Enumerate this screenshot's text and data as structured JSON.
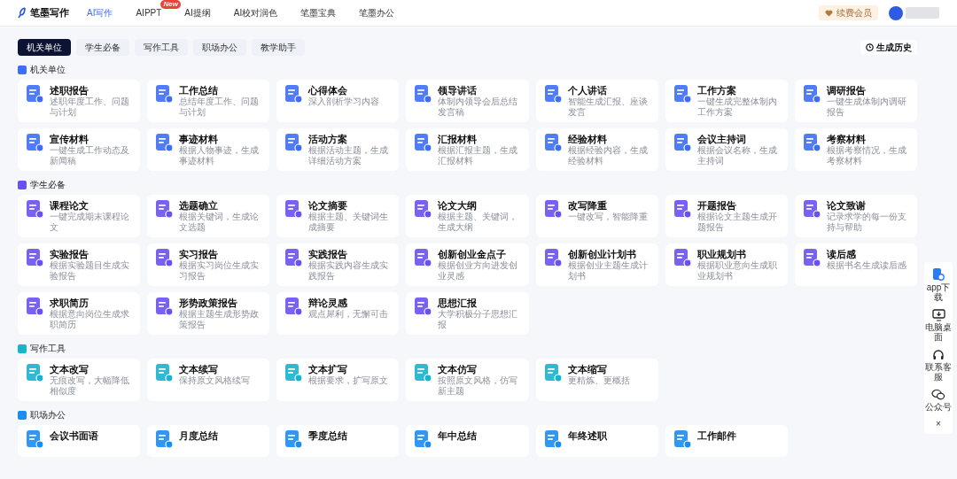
{
  "header": {
    "logo": "笔墨写作",
    "nav": [
      {
        "label": "AI写作",
        "selected": true
      },
      {
        "label": "AIPPT",
        "selected": false,
        "badge": "New"
      },
      {
        "label": "AI提纲",
        "selected": false
      },
      {
        "label": "AI校对润色",
        "selected": false
      },
      {
        "label": "笔墨宝典",
        "selected": false
      },
      {
        "label": "笔墨办公",
        "selected": false
      }
    ],
    "member_button": "续费会员"
  },
  "tabs": [
    {
      "label": "机关单位",
      "selected": true
    },
    {
      "label": "学生必备",
      "selected": false
    },
    {
      "label": "写作工具",
      "selected": false
    },
    {
      "label": "职场办公",
      "selected": false
    },
    {
      "label": "教学助手",
      "selected": false
    }
  ],
  "history_button": "生成历史",
  "sections": [
    {
      "title": "机关单位",
      "color": "#3d6ef5",
      "cards": [
        {
          "title": "述职报告",
          "desc": "述职年度工作、问题与计划"
        },
        {
          "title": "工作总结",
          "desc": "总结年度工作、问题与计划"
        },
        {
          "title": "心得体会",
          "desc": "深入剖析学习内容"
        },
        {
          "title": "领导讲话",
          "desc": "体制内领导会后总结发言稿"
        },
        {
          "title": "个人讲话",
          "desc": "智能生成汇报、座谈发言"
        },
        {
          "title": "工作方案",
          "desc": "一键生成完整体制内工作方案"
        },
        {
          "title": "调研报告",
          "desc": "一键生成体制内调研报告"
        },
        {
          "title": "宣传材料",
          "desc": "一键生成工作动态及新闻稿"
        },
        {
          "title": "事迹材料",
          "desc": "根据人物事迹，生成事迹材料"
        },
        {
          "title": "活动方案",
          "desc": "根据活动主题，生成详细活动方案"
        },
        {
          "title": "汇报材料",
          "desc": "根据汇报主题，生成汇报材料"
        },
        {
          "title": "经验材料",
          "desc": "根据经验内容，生成经验材料"
        },
        {
          "title": "会议主持词",
          "desc": "根据会议名称，生成主持词"
        },
        {
          "title": "考察材料",
          "desc": "根据考察情况，生成考察材料"
        }
      ]
    },
    {
      "title": "学生必备",
      "color": "#6a50f0",
      "cards": [
        {
          "title": "课程论文",
          "desc": "一键完成期末课程论文"
        },
        {
          "title": "选题确立",
          "desc": "根据关键词，生成论文选题"
        },
        {
          "title": "论文摘要",
          "desc": "根据主题、关键词生成摘要"
        },
        {
          "title": "论文大纲",
          "desc": "根据主题、关键词，生成大纲"
        },
        {
          "title": "改写降重",
          "desc": "一键改写，智能降重"
        },
        {
          "title": "开题报告",
          "desc": "根据论文主题生成开题报告"
        },
        {
          "title": "论文致谢",
          "desc": "记录求学的每一份支持与帮助"
        },
        {
          "title": "实验报告",
          "desc": "根据实验题目生成实验报告"
        },
        {
          "title": "实习报告",
          "desc": "根据实习岗位生成实习报告"
        },
        {
          "title": "实践报告",
          "desc": "根据实践内容生成实践报告"
        },
        {
          "title": "创新创业金点子",
          "desc": "根据创业方向进发创业灵感"
        },
        {
          "title": "创新创业计划书",
          "desc": "根据创业主题生成计划书"
        },
        {
          "title": "职业规划书",
          "desc": "根据职业意向生成职业规划书"
        },
        {
          "title": "读后感",
          "desc": "根据书名生成读后感"
        },
        {
          "title": "求职简历",
          "desc": "根据意向岗位生成求职简历"
        },
        {
          "title": "形势政策报告",
          "desc": "根据主题生成形势政策报告"
        },
        {
          "title": "辩论灵感",
          "desc": "观点犀利，无懈可击"
        },
        {
          "title": "思想汇报",
          "desc": "大学积极分子思想汇报"
        }
      ]
    },
    {
      "title": "写作工具",
      "color": "#17b4cc",
      "cards": [
        {
          "title": "文本改写",
          "desc": "无痕改写，大幅降低相似度"
        },
        {
          "title": "文本续写",
          "desc": "保持原文风格续写"
        },
        {
          "title": "文本扩写",
          "desc": "根据要求，扩写原文"
        },
        {
          "title": "文本仿写",
          "desc": "按照原文风格，仿写新主题"
        },
        {
          "title": "文本缩写",
          "desc": "更精炼、更概括"
        }
      ]
    },
    {
      "title": "职场办公",
      "color": "#1c8cf2",
      "cards": [
        {
          "title": "会议书面语"
        },
        {
          "title": "月度总结"
        },
        {
          "title": "季度总结"
        },
        {
          "title": "年中总结"
        },
        {
          "title": "年终述职"
        },
        {
          "title": "工作邮件"
        }
      ]
    }
  ],
  "side_panel": [
    {
      "label": "app下载",
      "kind": "app"
    },
    {
      "label": "电脑桌面",
      "kind": "desktop"
    },
    {
      "label": "联系客服",
      "kind": "support"
    },
    {
      "label": "公众号",
      "kind": "wechat"
    },
    {
      "label": "×",
      "kind": "close"
    }
  ]
}
